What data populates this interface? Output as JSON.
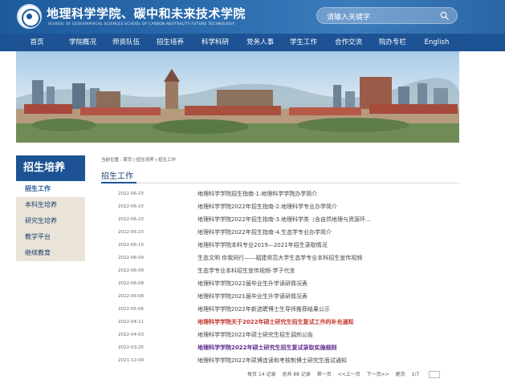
{
  "header": {
    "title_cn": "地理科学学院、碳中和未来技术学院",
    "title_en": "SCHOOL OF GEOGRAPHICAL SCIENCES   SCHOOL OF CARBON NEUTRALITY FUTURE TECHNOLOGY",
    "search_placeholder": "请输入关键字",
    "colors": {
      "primary": "#1d5394",
      "header": "#2d6eb0"
    }
  },
  "nav": {
    "items": [
      {
        "label": "首页"
      },
      {
        "label": "学院概况"
      },
      {
        "label": "师资队伍"
      },
      {
        "label": "招生培养"
      },
      {
        "label": "科学科研"
      },
      {
        "label": "党务人事"
      },
      {
        "label": "学生工作"
      },
      {
        "label": "合作交流"
      },
      {
        "label": "院办专栏"
      },
      {
        "label": "English"
      }
    ]
  },
  "sidebar": {
    "title": "招生培养",
    "items": [
      {
        "label": "招生工作",
        "active": true
      },
      {
        "label": "本科生培养",
        "active": false
      },
      {
        "label": "研究生培养",
        "active": false
      },
      {
        "label": "教学平台",
        "active": false
      },
      {
        "label": "继续教育",
        "active": false
      }
    ]
  },
  "breadcrumb": "当前位置 : 首页 | 招生培养 | 招生工作",
  "page_title": "招生工作",
  "news": [
    {
      "date": "2022-06-23",
      "title": "地理科学学院招生指南-1.地理科学学院办学简介",
      "style": "normal"
    },
    {
      "date": "2022-06-23",
      "title": "地理科学学院2022年招生指南-2.地理科学专业办学简介",
      "style": "normal"
    },
    {
      "date": "2022-06-23",
      "title": "地理科学学院2022年招生指南-3.地理科学类（含自然地理与资源环…",
      "style": "normal"
    },
    {
      "date": "2022-06-23",
      "title": "地理科学学院2022年招生指南-4.生态学专业办学简介",
      "style": "normal"
    },
    {
      "date": "2022-06-10",
      "title": "地理科学学院本科专业2019—2021年招生录取情况",
      "style": "normal"
    },
    {
      "date": "2022-06-09",
      "title": "生态文明 你我同行——福建师范大学生态学专业本科招生宣传视频",
      "style": "normal"
    },
    {
      "date": "2022-06-09",
      "title": "生态学专业本科招生宣传视频-学子代言",
      "style": "normal"
    },
    {
      "date": "2022-06-08",
      "title": "地理科学学院2022届毕业生升学读研情况表",
      "style": "normal"
    },
    {
      "date": "2022-06-08",
      "title": "地理科学学院2021届毕业生升学读研情况表",
      "style": "normal"
    },
    {
      "date": "2022-05-06",
      "title": "地理科学学院2022年新选聘博士生导师推荐结果公示",
      "style": "normal"
    },
    {
      "date": "2022-04-11",
      "title": "地理科学学院关于2022年硕士研究生招生复试工作的补充通知",
      "style": "red"
    },
    {
      "date": "2022-04-03",
      "title": "地理科学学院2022年硕士研究生招生调剂公告",
      "style": "normal"
    },
    {
      "date": "2022-03-25",
      "title": "地理科学学院2022年硕士研究生招生复试录取实施细则",
      "style": "purple"
    },
    {
      "date": "2021-12-09",
      "title": "地理科学学院2022年硕博连读和考核制博士研究生面试通知",
      "style": "normal"
    }
  ],
  "pagination": {
    "per_page": "每页 14 记录",
    "total": "总共 88 记录",
    "first": "第一页",
    "prev": "<<上一页",
    "next": "下一页>>",
    "last": "尾页",
    "jump": "页码",
    "goto": "1/7"
  }
}
